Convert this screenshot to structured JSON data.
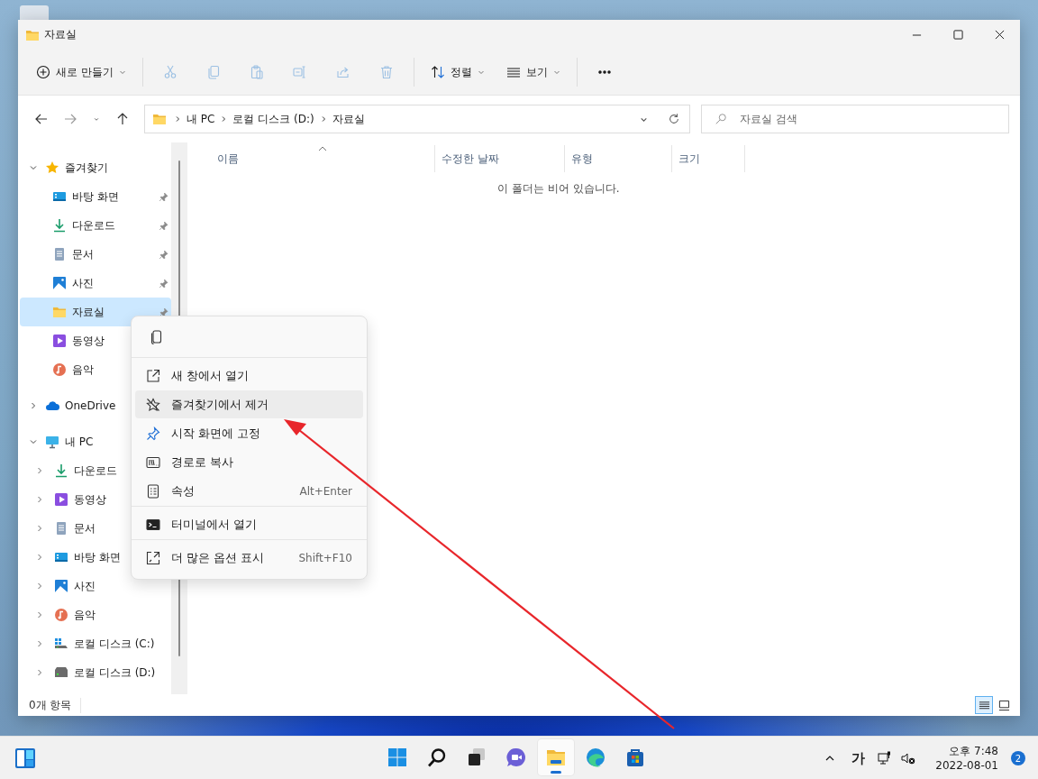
{
  "window": {
    "title": "자료실"
  },
  "toolbar": [
    [
      {
        "kind": "new",
        "label": "새로 만들기",
        "disabled": false
      }
    ],
    [
      {
        "kind": "cut",
        "disabled": true
      },
      {
        "kind": "copy",
        "disabled": true
      },
      {
        "kind": "paste",
        "disabled": true
      },
      {
        "kind": "rename",
        "disabled": true
      },
      {
        "kind": "share",
        "disabled": true
      },
      {
        "kind": "delete",
        "disabled": true
      }
    ],
    [
      {
        "kind": "sort",
        "label": "정렬",
        "disabled": false
      },
      {
        "kind": "view",
        "label": "보기",
        "disabled": false
      }
    ],
    [
      {
        "kind": "more",
        "disabled": false
      }
    ]
  ],
  "nav": [
    {
      "kind": "back",
      "disabled": false
    },
    {
      "kind": "forward",
      "disabled": true
    },
    {
      "kind": "recent",
      "disabled": false
    },
    {
      "kind": "up",
      "disabled": false
    }
  ],
  "address": {
    "segments": [
      "내 PC",
      "로컬 디스크 (D:)",
      "자료실"
    ]
  },
  "search": {
    "placeholder": "자료실 검색"
  },
  "sidebar": {
    "groups": [
      {
        "label": "즐겨찾기",
        "kind": "star",
        "expanded": true,
        "selected": false,
        "children": [
          {
            "label": "바탕 화면",
            "kind": "desktop",
            "pinned": true,
            "selected": false
          },
          {
            "label": "다운로드",
            "kind": "download",
            "pinned": true,
            "selected": false
          },
          {
            "label": "문서",
            "kind": "documents",
            "pinned": true,
            "selected": false
          },
          {
            "label": "사진",
            "kind": "pictures",
            "pinned": true,
            "selected": false
          },
          {
            "label": "자료실",
            "kind": "folder",
            "pinned": true,
            "selected": true
          },
          {
            "label": "동영상",
            "kind": "videos",
            "pinned": false,
            "selected": false
          },
          {
            "label": "음악",
            "kind": "music",
            "pinned": false,
            "selected": false
          }
        ]
      },
      {
        "label": "OneDrive",
        "kind": "cloud",
        "expanded": false,
        "selected": false
      },
      {
        "label": "내 PC",
        "kind": "pc",
        "expanded": true,
        "selected": false,
        "children": [
          {
            "label": "다운로드",
            "kind": "download",
            "expanded": false,
            "selected": false
          },
          {
            "label": "동영상",
            "kind": "videos",
            "expanded": false,
            "selected": false
          },
          {
            "label": "문서",
            "kind": "documents",
            "expanded": false,
            "selected": false
          },
          {
            "label": "바탕 화면",
            "kind": "desktop",
            "expanded": false,
            "selected": false
          },
          {
            "label": "사진",
            "kind": "pictures",
            "expanded": false,
            "selected": false
          },
          {
            "label": "음악",
            "kind": "music",
            "expanded": false,
            "selected": false
          },
          {
            "label": "로컬 디스크 (C:)",
            "kind": "drive-c",
            "expanded": false,
            "selected": false
          },
          {
            "label": "로컬 디스크 (D:)",
            "kind": "drive-d",
            "expanded": false,
            "selected": false
          }
        ]
      }
    ]
  },
  "columns": [
    {
      "label": "이름",
      "sorted": true
    },
    {
      "label": "수정한 날짜",
      "sorted": false
    },
    {
      "label": "유형",
      "sorted": false
    },
    {
      "label": "크기",
      "sorted": false
    }
  ],
  "empty_message": "이 폴더는 비어 있습니다.",
  "status_bar": {
    "count": "0개 항목",
    "views": [
      {
        "kind": "details",
        "selected": true
      },
      {
        "kind": "tiles",
        "selected": false
      }
    ]
  },
  "context_menu": {
    "top_actions": [
      {
        "kind": "copy"
      }
    ],
    "groups": [
      [
        {
          "kind": "open-new",
          "label": "새 창에서 열기",
          "selected": false
        },
        {
          "kind": "unstar",
          "label": "즐겨찾기에서 제거",
          "selected": true
        },
        {
          "kind": "pin",
          "label": "시작 화면에 고정",
          "selected": false
        },
        {
          "kind": "path",
          "label": "경로로 복사",
          "selected": false
        },
        {
          "kind": "properties",
          "label": "속성",
          "shortcut": "Alt+Enter",
          "selected": false
        }
      ],
      [
        {
          "kind": "terminal",
          "label": "터미널에서 열기",
          "selected": false
        }
      ],
      [
        {
          "kind": "more",
          "label": "더 많은 옵션 표시",
          "shortcut": "Shift+F10",
          "selected": false
        }
      ]
    ]
  },
  "taskbar": {
    "apps": [
      {
        "kind": "start",
        "selected": false
      },
      {
        "kind": "search",
        "selected": false
      },
      {
        "kind": "taskview",
        "selected": false
      },
      {
        "kind": "chat",
        "selected": false
      },
      {
        "kind": "explorer",
        "selected": true
      },
      {
        "kind": "edge",
        "selected": false
      },
      {
        "kind": "store",
        "selected": false
      }
    ],
    "ime": "가",
    "time": "오후 7:48",
    "date": "2022-08-01",
    "notifications": "2"
  }
}
